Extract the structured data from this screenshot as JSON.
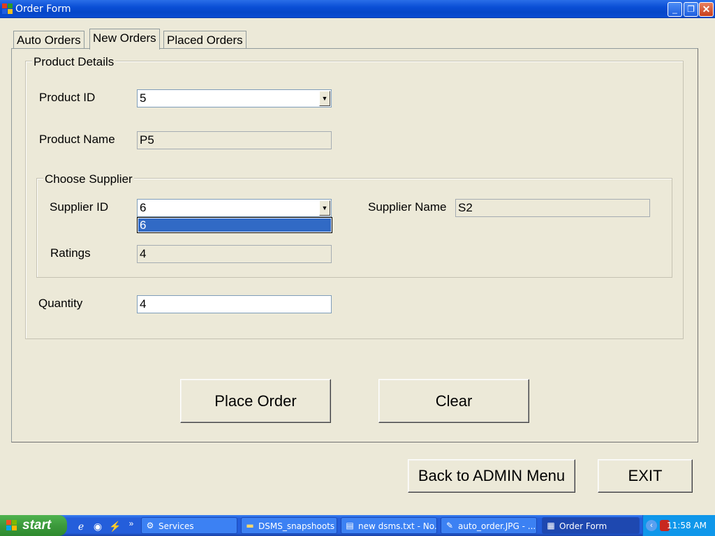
{
  "window": {
    "title": "Order Form",
    "minimize_glyph": "_",
    "restore_glyph": "❐",
    "close_glyph": "✕"
  },
  "tabs": [
    {
      "label": "Auto Orders",
      "active": false
    },
    {
      "label": "New Orders",
      "active": true
    },
    {
      "label": "Placed Orders",
      "active": false
    }
  ],
  "product_details": {
    "legend": "Product Details",
    "product_id": {
      "label": "Product ID",
      "value": "5"
    },
    "product_name": {
      "label": "Product Name",
      "value": "P5"
    }
  },
  "choose_supplier": {
    "legend": "Choose Supplier",
    "supplier_id": {
      "label": "Supplier ID",
      "value": "6",
      "dropdown_options": [
        "6"
      ]
    },
    "supplier_name": {
      "label": "Supplier Name",
      "value": "S2"
    },
    "ratings": {
      "label": "Ratings",
      "value": "4"
    }
  },
  "quantity": {
    "label": "Quantity",
    "value": "4"
  },
  "buttons": {
    "place_order": "Place Order",
    "clear": "Clear",
    "back_admin": "Back to ADMIN Menu",
    "exit": "EXIT"
  },
  "taskbar": {
    "start_label": "start",
    "overflow_glyph": "»",
    "items": [
      {
        "label": "Services",
        "icon": "gears-icon",
        "active": false
      },
      {
        "label": "DSMS_snapshoots",
        "icon": "folder-icon",
        "active": false
      },
      {
        "label": "new dsms.txt - No...",
        "icon": "notepad-icon",
        "active": false
      },
      {
        "label": "auto_order.JPG - ...",
        "icon": "paint-icon",
        "active": false
      },
      {
        "label": "Order Form",
        "icon": "form-icon",
        "active": true
      }
    ],
    "clock": "11:58 AM"
  },
  "colors": {
    "window_bg": "#ece9d8",
    "title_bar": "#0a4fd6",
    "selection": "#316ac5",
    "taskbar": "#245edb",
    "start_green": "#3c9a3c"
  }
}
